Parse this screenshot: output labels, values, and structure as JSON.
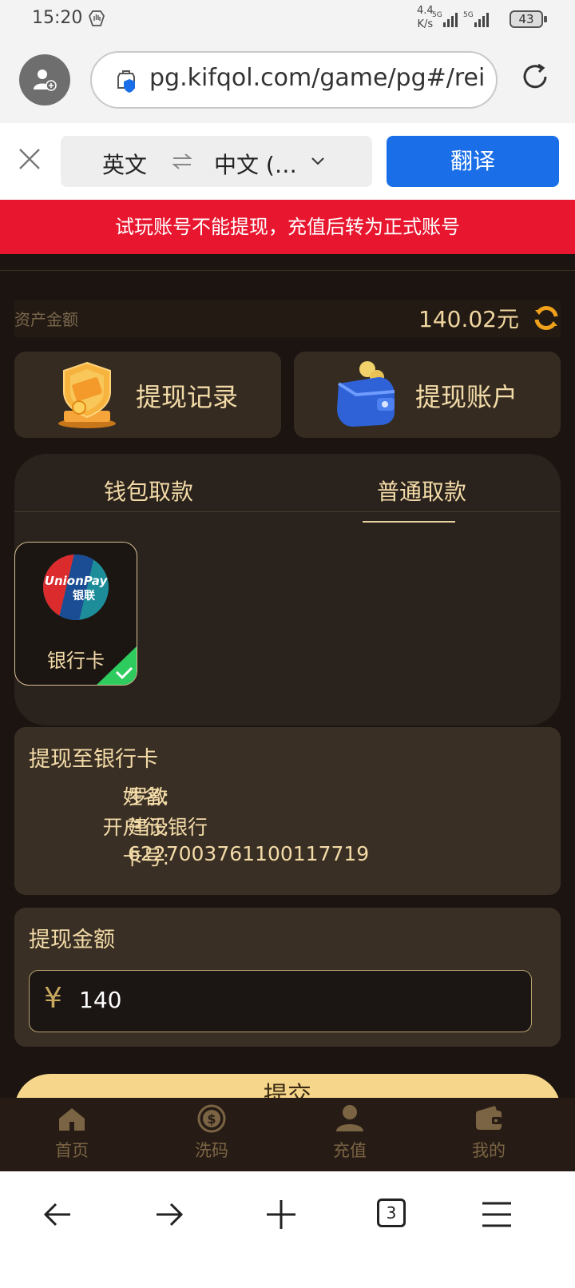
{
  "status_bar": {
    "time": "15:20",
    "net_speed_value": "4.4",
    "net_speed_unit": "K/s",
    "sim1": "5G",
    "sim2": "5G",
    "battery": "43"
  },
  "browser": {
    "url": "pg.kifqol.com/game/pg#/rei",
    "icons": [
      "account-icon",
      "site-security-icon",
      "reload-icon"
    ]
  },
  "translate_bar": {
    "source_lang": "英文",
    "target_lang": "中文 (…",
    "translate_button": "翻译"
  },
  "banner": {
    "text": "试玩账号不能提现，充值后转为正式账号"
  },
  "assets": {
    "label": "资产金额",
    "amount": "140.02元"
  },
  "quick_actions": [
    {
      "label": "提现记录",
      "icon": "shield-coin-icon"
    },
    {
      "label": "提现账户",
      "icon": "wallet-icon"
    }
  ],
  "tabs": [
    {
      "label": "钱包取款",
      "active": false
    },
    {
      "label": "普通取款",
      "active": true
    }
  ],
  "methods": [
    {
      "label": "银行卡",
      "logo_line1": "UnionPay",
      "logo_line2": "银联",
      "selected": true
    }
  ],
  "bank": {
    "title": "提现至银行卡",
    "name_label": "姓名:",
    "name_value": "罗教",
    "bank_label": "开户行:",
    "bank_value": "建设银行",
    "card_label": "卡号:",
    "card_value": "6227003761100117719"
  },
  "withdraw_amount": {
    "title": "提现金额",
    "currency_symbol": "¥",
    "value": "140"
  },
  "submit_label": "提交",
  "bottom_tabs": [
    {
      "label": "首页",
      "icon": "home-icon"
    },
    {
      "label": "洗码",
      "icon": "dollar-coin-icon"
    },
    {
      "label": "充值",
      "icon": "user-icon"
    },
    {
      "label": "我的",
      "icon": "wallet-icon"
    }
  ],
  "nav": {
    "tab_count": "3"
  }
}
